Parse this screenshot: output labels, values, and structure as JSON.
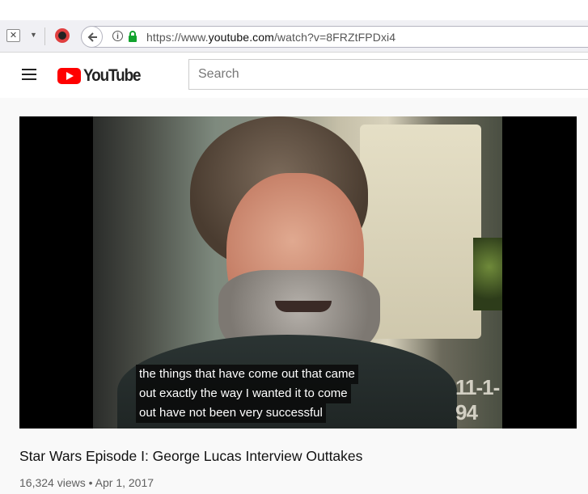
{
  "browser": {
    "url_prefix": "https://www.",
    "url_domain": "youtube.com",
    "url_path": "/watch?v=8FRZtFPDxi4"
  },
  "youtube": {
    "logo_text": "YouTube",
    "search_placeholder": "Search"
  },
  "video": {
    "captions": [
      "the things that have come out that came",
      "out exactly the way I wanted it to come",
      "out have not been very successful"
    ],
    "on_screen_date": "11-1-94",
    "title": "Star Wars Episode I: George Lucas Interview Outtakes",
    "views": "16,324 views",
    "separator": "•",
    "date": "Apr 1, 2017"
  },
  "colors": {
    "brand_red": "#ff0000"
  }
}
